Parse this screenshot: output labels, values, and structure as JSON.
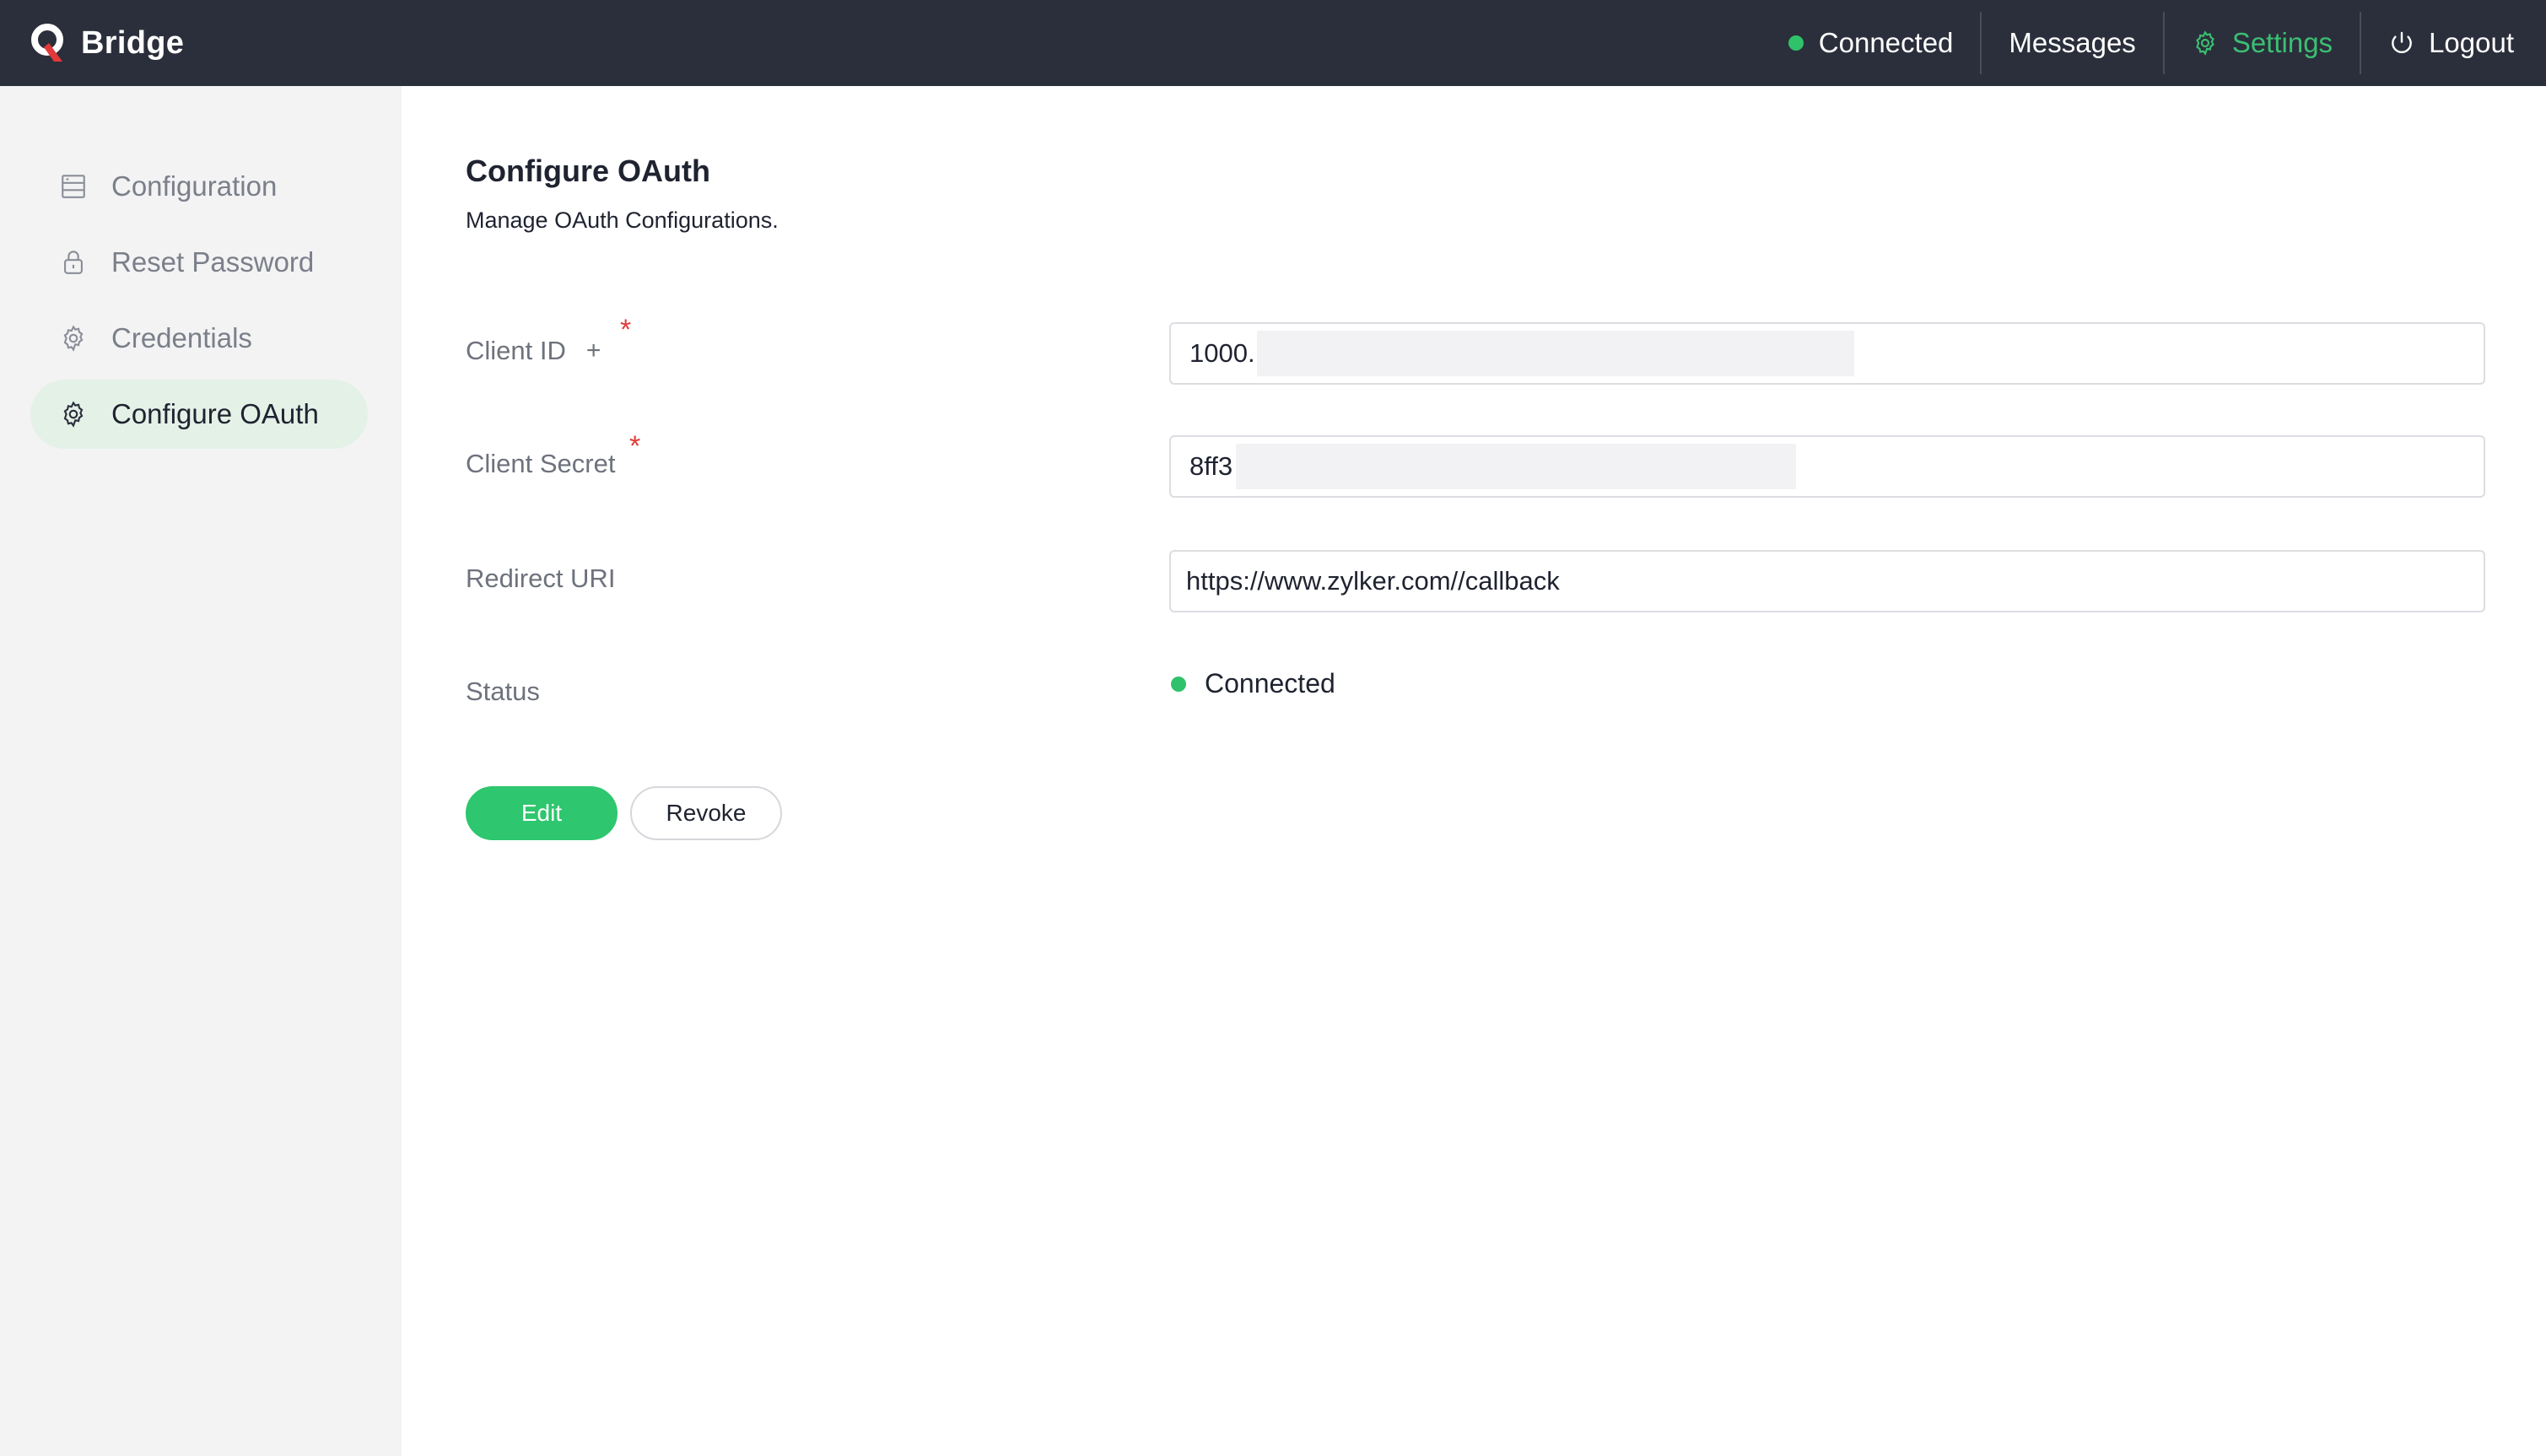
{
  "header": {
    "brand_name": "Bridge",
    "logo_icon": "bridge-q-logo",
    "nav": {
      "status_label": "Connected",
      "messages_label": "Messages",
      "settings_label": "Settings",
      "logout_label": "Logout"
    }
  },
  "sidebar": {
    "items": [
      {
        "label": "Configuration",
        "icon": "server-icon",
        "active": false
      },
      {
        "label": "Reset Password",
        "icon": "lock-icon",
        "active": false
      },
      {
        "label": "Credentials",
        "icon": "gear-icon",
        "active": false
      },
      {
        "label": "Configure OAuth",
        "icon": "gear-icon",
        "active": true
      }
    ]
  },
  "main": {
    "title": "Configure OAuth",
    "subtitle": "Manage OAuth Configurations.",
    "fields": {
      "client_id": {
        "label": "Client ID",
        "plus": "+",
        "required_mark": "*",
        "value": "1000."
      },
      "client_secret": {
        "label": "Client Secret",
        "required_mark": "*",
        "value": "8ff3"
      },
      "redirect_uri": {
        "label": "Redirect URI",
        "value": "https://www.zylker.com//callback"
      },
      "status": {
        "label": "Status",
        "value": "Connected"
      }
    },
    "buttons": {
      "edit_label": "Edit",
      "revoke_label": "Revoke"
    }
  },
  "colors": {
    "topbar_bg": "#2b2f3b",
    "accent_green": "#2ec66e",
    "sidebar_bg": "#f3f3f4",
    "active_item_bg": "#e4f1e7",
    "required_red": "#e23a3a"
  }
}
